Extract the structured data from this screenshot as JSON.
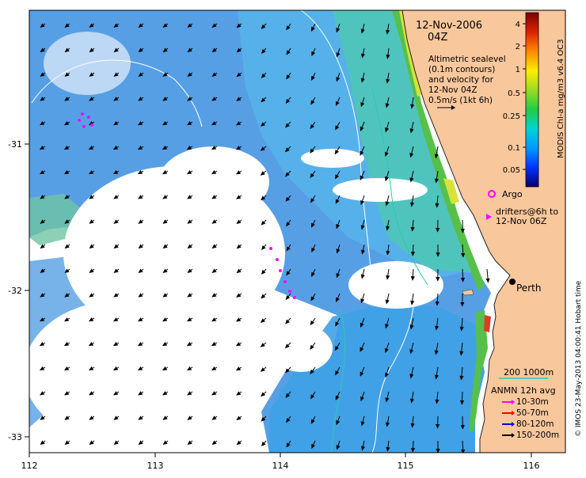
{
  "map": {
    "title_date": "12-Nov-2006",
    "title_time": "04Z",
    "x_ticks": [
      "112",
      "113",
      "114",
      "115",
      "116"
    ],
    "y_ticks": [
      "-31",
      "-32",
      "-33"
    ],
    "city": "Perth",
    "colors": {
      "land": "#f9c79c",
      "water_low": "#3a8ee0",
      "water_mid": "#6bc5e8",
      "coast_green": "#56c04a",
      "coast_yellow": "#d8e23a",
      "coast_red": "#d8402a",
      "vector": "#000000",
      "contour": "#ffffff"
    }
  },
  "legend": {
    "altimetry_lines": [
      "Altimetric sealevel",
      "(0.1m contours)",
      "and velocity for",
      "12-Nov 04Z",
      "0.5m/s (1kt 6h)"
    ],
    "argo": "Argo",
    "drifters_line1": "drifters@6h to",
    "drifters_line2": "12-Nov 06Z",
    "depth_scale": "200  1000m",
    "anmn_title": "ANMN 12h avg",
    "anmn_items": [
      {
        "label": "10-30m",
        "color": "#ff00ff"
      },
      {
        "label": "50-70m",
        "color": "#ff0000"
      },
      {
        "label": "80-120m",
        "color": "#0000ff"
      },
      {
        "label": "150-200m",
        "color": "#000000"
      }
    ]
  },
  "colorbar": {
    "label": "MODIS Chl-a mg/m3 v6.4 OC3",
    "ticks": [
      "4",
      "2",
      "1",
      "0.5",
      "0.25",
      "0.1",
      "0.05"
    ],
    "colors": [
      "#00006e",
      "#0033ff",
      "#0099ff",
      "#00d4d4",
      "#22cc44",
      "#99dd22",
      "#ffee00",
      "#ff8800",
      "#dd2200",
      "#7a0000"
    ]
  },
  "credit": "© IMOS 23-May-2013 04:00:41 Hobart time"
}
